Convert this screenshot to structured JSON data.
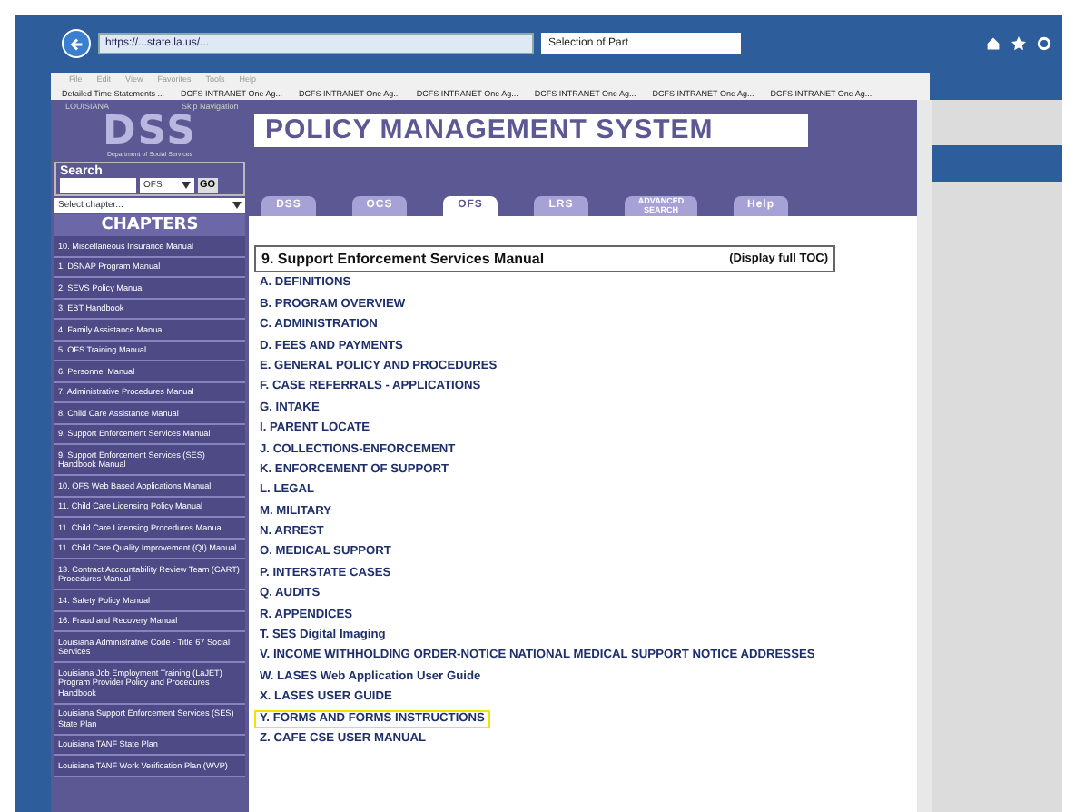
{
  "browser": {
    "url": "https://...state.la.us/...",
    "tab_title": "Selection of Part",
    "menu": [
      "File",
      "Edit",
      "View",
      "Favorites",
      "Tools",
      "Help"
    ],
    "favorites": [
      "Detailed Time Statements ...",
      "DCFS INTRANET One Ag...",
      "DCFS INTRANET One Ag...",
      "DCFS INTRANET One Ag...",
      "DCFS INTRANET One Ag...",
      "DCFS INTRANET One Ag...",
      "DCFS INTRANET One Ag..."
    ]
  },
  "header": {
    "state": "LOUISIANA",
    "skip_link": "Skip Navigation",
    "logo": "DSS",
    "logo_caption": "Department of Social Services",
    "title": "POLICY MANAGEMENT SYSTEM"
  },
  "search": {
    "label": "Search",
    "scope": "OFS",
    "button": "GO",
    "chapter_select": "Select chapter..."
  },
  "tabs": [
    {
      "label": "DSS",
      "selected": false
    },
    {
      "label": "OCS",
      "selected": false
    },
    {
      "label": "OFS",
      "selected": true
    },
    {
      "label": "LRS",
      "selected": false
    },
    {
      "label": "ADVANCED SEARCH",
      "selected": false
    },
    {
      "label": "Help",
      "selected": false
    }
  ],
  "chapters_heading": "CHAPTERS",
  "chapters": [
    "10. Miscellaneous Insurance Manual",
    "1. DSNAP Program Manual",
    "2. SEVS Policy Manual",
    "3. EBT Handbook",
    "4. Family Assistance Manual",
    "5. OFS Training Manual",
    "6. Personnel Manual",
    "7. Administrative Procedures Manual",
    "8. Child Care Assistance Manual",
    "9. Support Enforcement Services Manual",
    "9. Support Enforcement Services (SES) Handbook Manual",
    "10. OFS Web Based Applications Manual",
    "11. Child Care Licensing Policy Manual",
    "11. Child Care Licensing Procedures Manual",
    "11. Child Care Quality Improvement (QI) Manual",
    "13. Contract Accountability Review Team (CART) Procedures Manual",
    "14. Safety Policy Manual",
    "16. Fraud and Recovery Manual",
    "Louisiana Administrative Code - Title 67 Social Services",
    "Louisiana Job Employment Training (LaJET) Program Provider Policy and Procedures Handbook",
    "Louisiana Support Enforcement Services (SES) State Plan",
    "Louisiana TANF State Plan",
    "Louisiana TANF Work Verification Plan (WVP)"
  ],
  "toc": {
    "title": "9. Support Enforcement Services Manual",
    "full_toc_link": "(Display full TOC)",
    "sections": [
      {
        "label": "A. DEFINITIONS",
        "highlighted": false
      },
      {
        "label": "B. PROGRAM OVERVIEW",
        "highlighted": false
      },
      {
        "label": "C. ADMINISTRATION",
        "highlighted": false
      },
      {
        "label": "D. FEES AND PAYMENTS",
        "highlighted": false
      },
      {
        "label": "E. GENERAL POLICY AND PROCEDURES",
        "highlighted": false
      },
      {
        "label": "F. CASE REFERRALS - APPLICATIONS",
        "highlighted": false
      },
      {
        "label": "G. INTAKE",
        "highlighted": false
      },
      {
        "label": "I. PARENT LOCATE",
        "highlighted": false
      },
      {
        "label": "J. COLLECTIONS-ENFORCEMENT",
        "highlighted": false
      },
      {
        "label": "K. ENFORCEMENT OF SUPPORT",
        "highlighted": false
      },
      {
        "label": "L. LEGAL",
        "highlighted": false
      },
      {
        "label": "M. MILITARY",
        "highlighted": false
      },
      {
        "label": "N. ARREST",
        "highlighted": false
      },
      {
        "label": "O. MEDICAL SUPPORT",
        "highlighted": false
      },
      {
        "label": "P. INTERSTATE CASES",
        "highlighted": false
      },
      {
        "label": "Q. AUDITS",
        "highlighted": false
      },
      {
        "label": "R. APPENDICES",
        "highlighted": false
      },
      {
        "label": "T. SES Digital Imaging",
        "highlighted": false
      },
      {
        "label": "V. INCOME WITHHOLDING ORDER-NOTICE NATIONAL MEDICAL SUPPORT NOTICE ADDRESSES",
        "highlighted": false
      },
      {
        "label": "W. LASES Web Application User Guide",
        "highlighted": false
      },
      {
        "label": "X. LASES USER GUIDE",
        "highlighted": false
      },
      {
        "label": "Y. FORMS AND FORMS INSTRUCTIONS",
        "highlighted": true
      },
      {
        "label": "Z. CAFE CSE USER MANUAL",
        "highlighted": false
      }
    ]
  }
}
